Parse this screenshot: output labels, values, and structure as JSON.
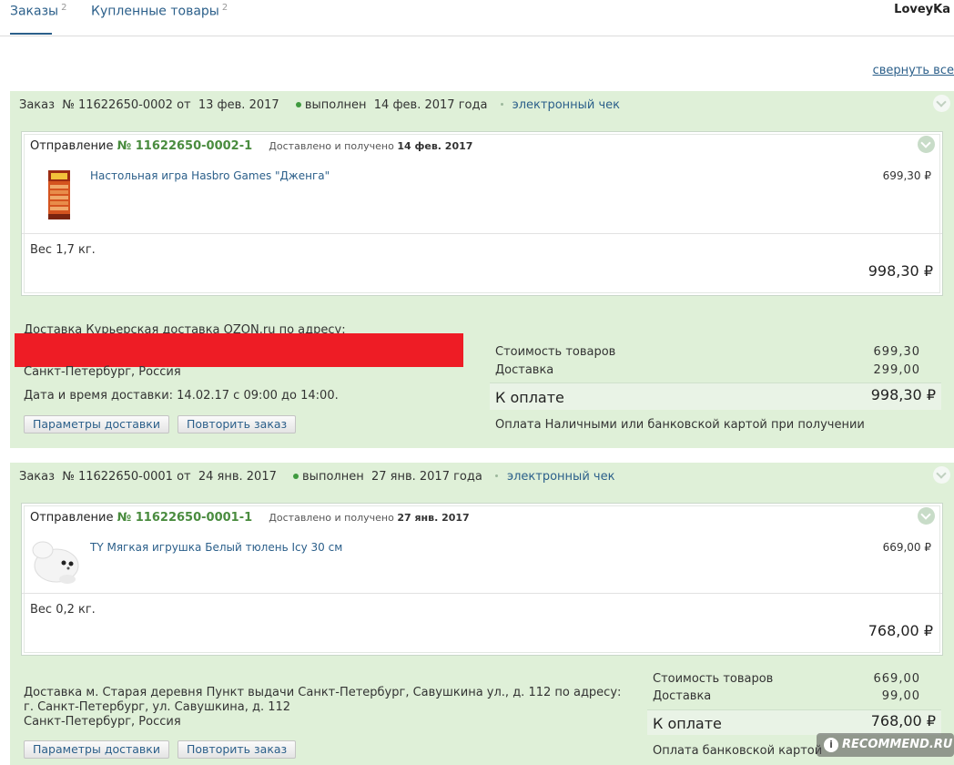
{
  "tabs": {
    "orders_label": "Заказы",
    "orders_count": "2",
    "purchased_label": "Купленные товары",
    "purchased_count": "2",
    "username": "LoveyKa"
  },
  "collapse_all": "свернуть все",
  "orders": [
    {
      "header": {
        "prefix": "Заказ",
        "number": "№ 11622650-0002",
        "from": "от",
        "date": "13 фев. 2017",
        "status": "выполнен",
        "status_date": "14 фев. 2017 года",
        "receipt": "электронный чек"
      },
      "shipment": {
        "label": "Отправление",
        "number": "№ 11622650-0002-1",
        "status_text": "Доставлено и получено",
        "status_date": "14 фев. 2017",
        "product_name": "Настольная игра Hasbro Games \"Дженга\"",
        "product_price": "699,30 ₽",
        "weight": "Вес 1,7 кг.",
        "total": "998,30 ₽"
      },
      "delivery": {
        "line1": "Доставка Курьерская доставка OZON.ru по адресу:",
        "city": "Санкт-Петербург, Россия",
        "datetime": "Дата и время доставки: 14.02.17 с 09:00 до 14:00."
      },
      "buttons": {
        "params": "Параметры доставки",
        "repeat": "Повторить заказ"
      },
      "summary": {
        "goods_label": "Стоимость товаров",
        "goods_value": "699,30",
        "delivery_label": "Доставка",
        "delivery_value": "299,00",
        "pay_label": "К оплате",
        "pay_value": "998,30 ₽",
        "method": "Оплата Наличными или банковской картой при получении"
      }
    },
    {
      "header": {
        "prefix": "Заказ",
        "number": "№ 11622650-0001",
        "from": "от",
        "date": "24 янв. 2017",
        "status": "выполнен",
        "status_date": "27 янв. 2017 года",
        "receipt": "электронный чек"
      },
      "shipment": {
        "label": "Отправление",
        "number": "№ 11622650-0001-1",
        "status_text": "Доставлено и получено",
        "status_date": "27 янв. 2017",
        "product_name": "TY Мягкая игрушка Белый тюлень Icy 30 см",
        "product_price": "669,00 ₽",
        "weight": "Вес 0,2 кг.",
        "total": "768,00 ₽"
      },
      "delivery": {
        "line1": "Доставка м. Старая деревня Пункт выдачи Санкт-Петербург, Савушкина ул., д. 112 по адресу:",
        "line2": "г. Санкт-Петербург, ул. Савушкина, д. 112",
        "city": "Санкт-Петербург, Россия"
      },
      "buttons": {
        "params": "Параметры доставки",
        "repeat": "Повторить заказ"
      },
      "summary": {
        "goods_label": "Стоимость товаров",
        "goods_value": "669,00",
        "delivery_label": "Доставка",
        "delivery_value": "99,00",
        "pay_label": "К оплате",
        "pay_value": "768,00 ₽",
        "method": "Оплата банковской картой"
      }
    }
  ],
  "watermark": "RECOMMEND.RU",
  "colors": {
    "order_bg": "#dff0d8",
    "link": "#2b5f8a",
    "shipment_number": "#4a8c3f",
    "redaction": "#ee1c25"
  }
}
